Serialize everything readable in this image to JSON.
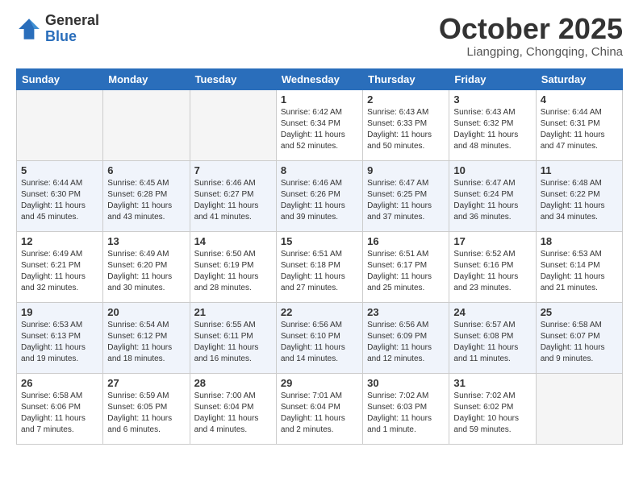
{
  "logo": {
    "general": "General",
    "blue": "Blue"
  },
  "header": {
    "month": "October 2025",
    "location": "Liangping, Chongqing, China"
  },
  "weekdays": [
    "Sunday",
    "Monday",
    "Tuesday",
    "Wednesday",
    "Thursday",
    "Friday",
    "Saturday"
  ],
  "weeks": [
    [
      {
        "day": "",
        "info": ""
      },
      {
        "day": "",
        "info": ""
      },
      {
        "day": "",
        "info": ""
      },
      {
        "day": "1",
        "info": "Sunrise: 6:42 AM\nSunset: 6:34 PM\nDaylight: 11 hours\nand 52 minutes."
      },
      {
        "day": "2",
        "info": "Sunrise: 6:43 AM\nSunset: 6:33 PM\nDaylight: 11 hours\nand 50 minutes."
      },
      {
        "day": "3",
        "info": "Sunrise: 6:43 AM\nSunset: 6:32 PM\nDaylight: 11 hours\nand 48 minutes."
      },
      {
        "day": "4",
        "info": "Sunrise: 6:44 AM\nSunset: 6:31 PM\nDaylight: 11 hours\nand 47 minutes."
      }
    ],
    [
      {
        "day": "5",
        "info": "Sunrise: 6:44 AM\nSunset: 6:30 PM\nDaylight: 11 hours\nand 45 minutes."
      },
      {
        "day": "6",
        "info": "Sunrise: 6:45 AM\nSunset: 6:28 PM\nDaylight: 11 hours\nand 43 minutes."
      },
      {
        "day": "7",
        "info": "Sunrise: 6:46 AM\nSunset: 6:27 PM\nDaylight: 11 hours\nand 41 minutes."
      },
      {
        "day": "8",
        "info": "Sunrise: 6:46 AM\nSunset: 6:26 PM\nDaylight: 11 hours\nand 39 minutes."
      },
      {
        "day": "9",
        "info": "Sunrise: 6:47 AM\nSunset: 6:25 PM\nDaylight: 11 hours\nand 37 minutes."
      },
      {
        "day": "10",
        "info": "Sunrise: 6:47 AM\nSunset: 6:24 PM\nDaylight: 11 hours\nand 36 minutes."
      },
      {
        "day": "11",
        "info": "Sunrise: 6:48 AM\nSunset: 6:22 PM\nDaylight: 11 hours\nand 34 minutes."
      }
    ],
    [
      {
        "day": "12",
        "info": "Sunrise: 6:49 AM\nSunset: 6:21 PM\nDaylight: 11 hours\nand 32 minutes."
      },
      {
        "day": "13",
        "info": "Sunrise: 6:49 AM\nSunset: 6:20 PM\nDaylight: 11 hours\nand 30 minutes."
      },
      {
        "day": "14",
        "info": "Sunrise: 6:50 AM\nSunset: 6:19 PM\nDaylight: 11 hours\nand 28 minutes."
      },
      {
        "day": "15",
        "info": "Sunrise: 6:51 AM\nSunset: 6:18 PM\nDaylight: 11 hours\nand 27 minutes."
      },
      {
        "day": "16",
        "info": "Sunrise: 6:51 AM\nSunset: 6:17 PM\nDaylight: 11 hours\nand 25 minutes."
      },
      {
        "day": "17",
        "info": "Sunrise: 6:52 AM\nSunset: 6:16 PM\nDaylight: 11 hours\nand 23 minutes."
      },
      {
        "day": "18",
        "info": "Sunrise: 6:53 AM\nSunset: 6:14 PM\nDaylight: 11 hours\nand 21 minutes."
      }
    ],
    [
      {
        "day": "19",
        "info": "Sunrise: 6:53 AM\nSunset: 6:13 PM\nDaylight: 11 hours\nand 19 minutes."
      },
      {
        "day": "20",
        "info": "Sunrise: 6:54 AM\nSunset: 6:12 PM\nDaylight: 11 hours\nand 18 minutes."
      },
      {
        "day": "21",
        "info": "Sunrise: 6:55 AM\nSunset: 6:11 PM\nDaylight: 11 hours\nand 16 minutes."
      },
      {
        "day": "22",
        "info": "Sunrise: 6:56 AM\nSunset: 6:10 PM\nDaylight: 11 hours\nand 14 minutes."
      },
      {
        "day": "23",
        "info": "Sunrise: 6:56 AM\nSunset: 6:09 PM\nDaylight: 11 hours\nand 12 minutes."
      },
      {
        "day": "24",
        "info": "Sunrise: 6:57 AM\nSunset: 6:08 PM\nDaylight: 11 hours\nand 11 minutes."
      },
      {
        "day": "25",
        "info": "Sunrise: 6:58 AM\nSunset: 6:07 PM\nDaylight: 11 hours\nand 9 minutes."
      }
    ],
    [
      {
        "day": "26",
        "info": "Sunrise: 6:58 AM\nSunset: 6:06 PM\nDaylight: 11 hours\nand 7 minutes."
      },
      {
        "day": "27",
        "info": "Sunrise: 6:59 AM\nSunset: 6:05 PM\nDaylight: 11 hours\nand 6 minutes."
      },
      {
        "day": "28",
        "info": "Sunrise: 7:00 AM\nSunset: 6:04 PM\nDaylight: 11 hours\nand 4 minutes."
      },
      {
        "day": "29",
        "info": "Sunrise: 7:01 AM\nSunset: 6:04 PM\nDaylight: 11 hours\nand 2 minutes."
      },
      {
        "day": "30",
        "info": "Sunrise: 7:02 AM\nSunset: 6:03 PM\nDaylight: 11 hours\nand 1 minute."
      },
      {
        "day": "31",
        "info": "Sunrise: 7:02 AM\nSunset: 6:02 PM\nDaylight: 10 hours\nand 59 minutes."
      },
      {
        "day": "",
        "info": ""
      }
    ]
  ]
}
